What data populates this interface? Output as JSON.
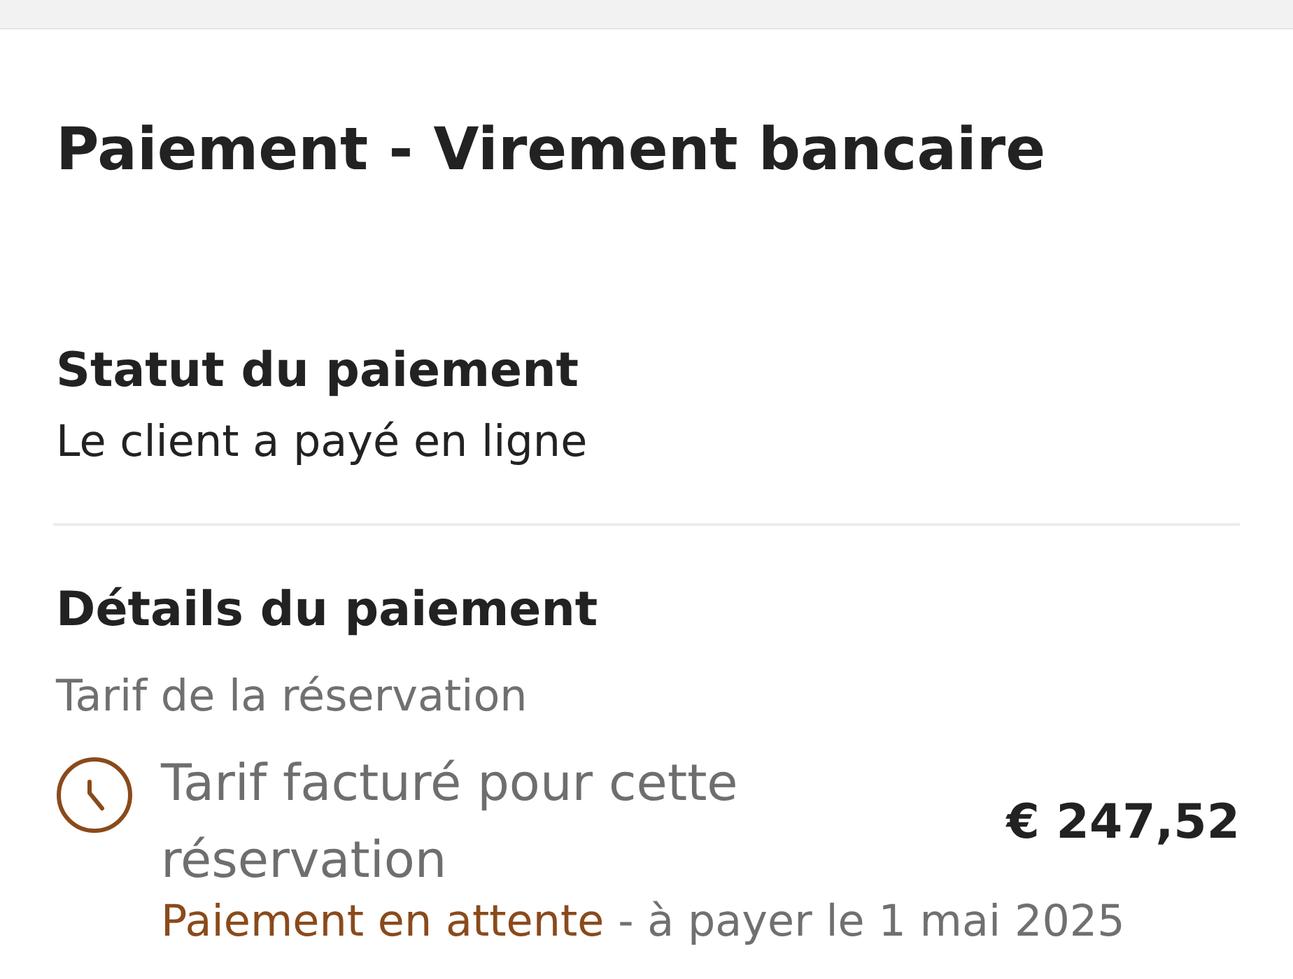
{
  "page": {
    "title": "Paiement - Virement bancaire"
  },
  "payment_status": {
    "heading": "Statut du paiement",
    "text": "Le client a payé en ligne"
  },
  "payment_details": {
    "heading": "Détails du paiement",
    "subheading": "Tarif de la réservation",
    "line_item": {
      "label": "Tarif facturé pour cette réservation",
      "amount": "€ 247,52",
      "status": "Paiement en attente",
      "due_note": "- à payer le 1 mai 2025"
    }
  }
}
